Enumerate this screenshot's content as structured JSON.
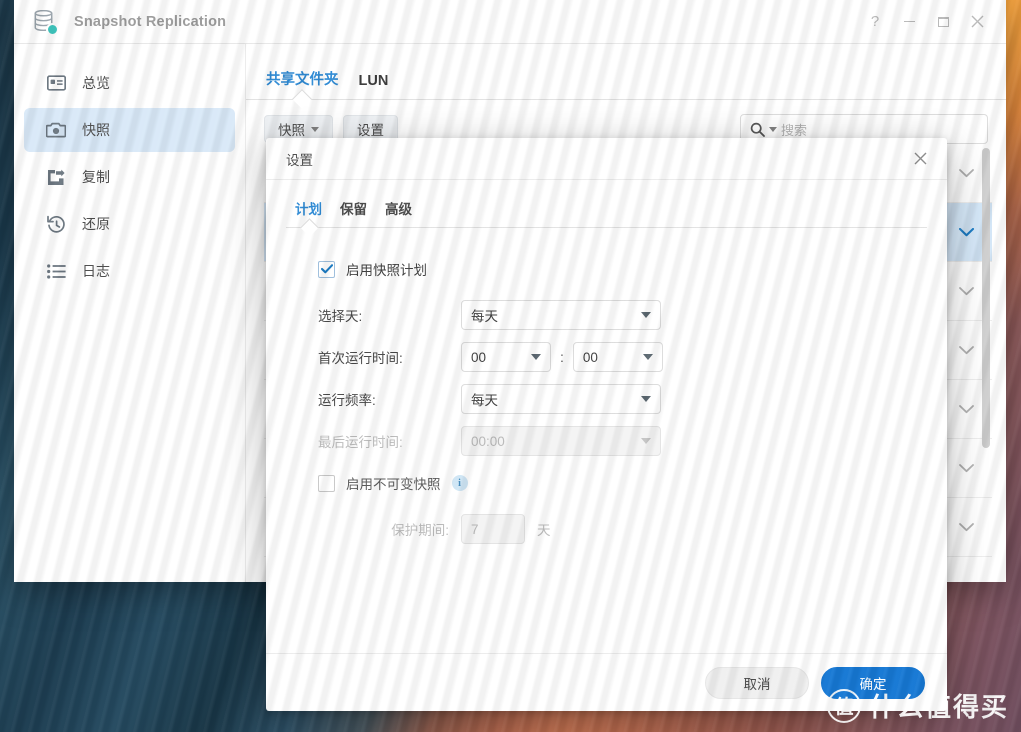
{
  "window": {
    "title": "Snapshot Replication",
    "app_icon": "database-stack-icon",
    "controls": {
      "help": "?",
      "minimize": "minimize-icon",
      "maximize": "restore-icon",
      "close": "close-icon"
    }
  },
  "sidebar": {
    "items": [
      {
        "label": "总览",
        "icon": "overview-card-icon",
        "active": false
      },
      {
        "label": "快照",
        "icon": "camera-icon",
        "active": true
      },
      {
        "label": "复制",
        "icon": "replicate-arrow-icon",
        "active": false
      },
      {
        "label": "还原",
        "icon": "restore-clock-icon",
        "active": false
      },
      {
        "label": "日志",
        "icon": "list-log-icon",
        "active": false
      }
    ]
  },
  "main": {
    "tabs": [
      {
        "label": "共享文件夹",
        "active": true
      },
      {
        "label": "LUN",
        "active": false
      }
    ],
    "toolbar": {
      "snapshot_button": "快照",
      "settings_button": "设置",
      "snapshot_has_caret": true
    },
    "search": {
      "placeholder": "搜索",
      "icon": "search-icon",
      "caret": "dropdown-caret-icon"
    },
    "list": {
      "chevron_icon": "chevron-down-icon",
      "rows": [
        {
          "selected": false
        },
        {
          "selected": true
        },
        {
          "selected": false
        },
        {
          "selected": false
        },
        {
          "selected": false
        },
        {
          "selected": false
        },
        {
          "selected": false
        },
        {
          "selected": false
        }
      ]
    }
  },
  "dialog": {
    "title": "设置",
    "close_icon": "close-icon",
    "tabs": [
      {
        "label": "计划",
        "active": true
      },
      {
        "label": "保留",
        "active": false
      },
      {
        "label": "高级",
        "active": false
      }
    ],
    "form": {
      "enable_schedule": {
        "label": "启用快照计划",
        "checked": true
      },
      "select_day": {
        "label": "选择天:",
        "value": "每天"
      },
      "first_run_time": {
        "label": "首次运行时间:",
        "hour": "00",
        "separator": ":",
        "minute": "00"
      },
      "frequency": {
        "label": "运行频率:",
        "value": "每天"
      },
      "last_run_time": {
        "label": "最后运行时间:",
        "value": "00:00",
        "disabled": true
      },
      "immutable_snapshot": {
        "label": "启用不可变快照",
        "checked": false,
        "info_icon": "info-icon"
      },
      "protection_period": {
        "label": "保护期间:",
        "value": "7",
        "unit": "天",
        "disabled": true
      }
    },
    "footer": {
      "cancel": "取消",
      "confirm": "确定"
    }
  },
  "watermark": {
    "logo": "值",
    "text": "什么值得买"
  },
  "colors": {
    "accent": "#2e8ad4",
    "primary_button": "#1678d4",
    "selected_row": "#d3e6f7",
    "sidebar_active": "#d9e9f8",
    "app_badge": "#3fc8c0"
  }
}
